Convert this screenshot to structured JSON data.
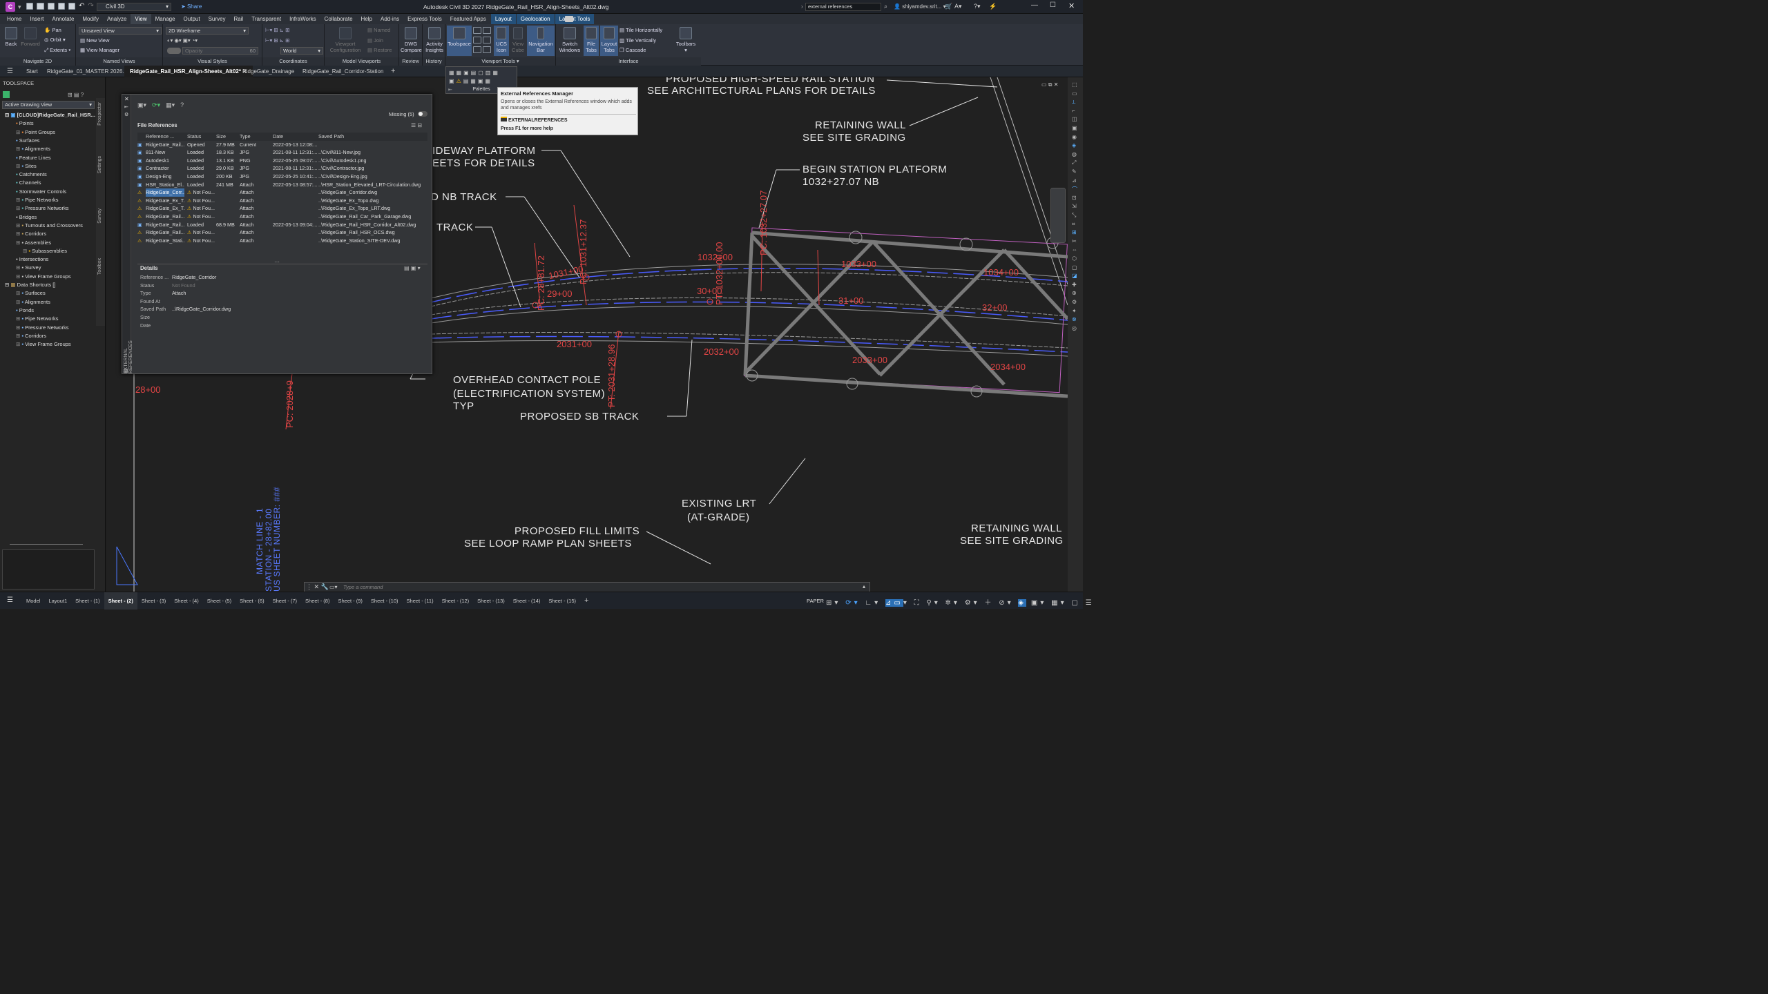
{
  "titlebar": {
    "app_badge": "C",
    "workspace": "Civil 3D",
    "share": "Share",
    "title": "Autodesk Civil 3D 2027   RidgeGate_Rail_HSR_Align-Sheets_Alt02.dwg",
    "search_value": "external references",
    "user": "shiyamdev.srit..."
  },
  "menu": {
    "items": [
      "Home",
      "Insert",
      "Annotate",
      "Modify",
      "Analyze",
      "View",
      "Manage",
      "Output",
      "Survey",
      "Rail",
      "Transparent",
      "InfraWorks",
      "Collaborate",
      "Help",
      "Add-ins",
      "Express Tools",
      "Featured Apps"
    ],
    "active": "View",
    "contextual": [
      "Layout",
      "Geolocation",
      "Layout Tools"
    ]
  },
  "ribbon": {
    "navigate": {
      "back": "Back",
      "forward": "Forward",
      "pan": "Pan",
      "orbit": "Orbit",
      "extents": "Extents",
      "label": "Navigate 2D"
    },
    "named_views": {
      "dropdown": "Unsaved View",
      "new": "New View",
      "manager": "View Manager",
      "label": "Named Views"
    },
    "visual_styles": {
      "dropdown": "2D Wireframe",
      "opacity": "Opacity",
      "opacity_value": "60",
      "label": "Visual Styles"
    },
    "coordinates": {
      "world": "World",
      "label": "Coordinates"
    },
    "model_viewports": {
      "config": "Viewport Configuration",
      "named": "Named",
      "join": "Join",
      "restore": "Restore",
      "label": "Model Viewports"
    },
    "review": {
      "dwg_compare": "DWG Compare",
      "label": "Review"
    },
    "history": {
      "activity": "Activity Insights",
      "label": "History"
    },
    "viewport_tools": {
      "toolspace": "Toolspace",
      "ucs": "UCS Icon",
      "viewcube": "View Cube",
      "navbar": "Navigation Bar",
      "label": "Viewport Tools"
    },
    "interface": {
      "switch": "Switch Windows",
      "file_tabs": "File Tabs",
      "layout_tabs": "Layout Tabs",
      "tile_h": "Tile Horizontally",
      "tile_v": "Tile Vertically",
      "cascade": "Cascade",
      "toolbars": "Toolbars",
      "label": "Interface"
    },
    "palettes_label": "Palettes"
  },
  "tabs": {
    "start": "Start",
    "items": [
      {
        "label": "RidgeGate_01_MASTER 2026.1*"
      },
      {
        "label": "RidgeGate_Rail_HSR_Align-Sheets_Alt02*"
      },
      {
        "label": "RidgeGate_Drainage"
      },
      {
        "label": "RidgeGate_Rail_Corridor-Station"
      }
    ]
  },
  "toolspace": {
    "title": "TOOLSPACE",
    "view": "Active Drawing View",
    "root": "[CLOUD]RidgeGate_Rail_HSR...",
    "items": [
      "Points",
      "Point Groups",
      "Surfaces",
      "Alignments",
      "Feature Lines",
      "Sites",
      "Catchments",
      "Channels",
      "Stormwater Controls",
      "Pipe Networks",
      "Pressure Networks",
      "Bridges",
      "Turnouts and Crossovers",
      "Corridors",
      "Assemblies",
      "Subassemblies",
      "Intersections",
      "Survey",
      "View Frame Groups"
    ],
    "shortcuts_root": "Data Shortcuts []",
    "shortcuts": [
      "Surfaces",
      "Alignments",
      "Ponds",
      "Pipe Networks",
      "Pressure Networks",
      "Corridors",
      "View Frame Groups"
    ],
    "side_tabs": [
      "Prospector",
      "Settings",
      "Survey",
      "Toolbox"
    ]
  },
  "xref": {
    "palette_title": "EXTERNAL REFERENCES",
    "missing": "Missing (5)",
    "file_refs": "File References",
    "columns": [
      "Reference ...",
      "Status",
      "Size",
      "Type",
      "Date",
      "Saved Path"
    ],
    "rows": [
      [
        "RidgeGate_Rail...",
        "Opened",
        "27.9 MB",
        "Current",
        "2022-05-13 12:08:...",
        ""
      ],
      [
        "811-New",
        "Loaded",
        "18.3 KB",
        "JPG",
        "2021-08-11 12:31:...",
        "..\\Civil\\811-New.jpg"
      ],
      [
        "Autodesk1",
        "Loaded",
        "13.1 KB",
        "PNG",
        "2022-05-25 09:07:...",
        "..\\Civil\\Autodesk1.png"
      ],
      [
        "Contractor",
        "Loaded",
        "29.0 KB",
        "JPG",
        "2021-08-11 12:31:...",
        "..\\Civil\\Contractor.jpg"
      ],
      [
        "Design-Eng",
        "Loaded",
        "200 KB",
        "JPG",
        "2022-05-25 10:41:...",
        "..\\Civil\\Design-Eng.jpg"
      ],
      [
        "HSR_Station_El...",
        "Loaded",
        "241 MB",
        "Attach",
        "2022-05-13 08:57:...",
        "..\\HSR_Station_Elevated_LRT-Circulation.dwg"
      ],
      [
        "RidgeGate_Corr...",
        "Not Fou...",
        "",
        "Attach",
        "",
        "..\\RidgeGate_Corridor.dwg"
      ],
      [
        "RidgeGate_Ex_T...",
        "Not Fou...",
        "",
        "Attach",
        "",
        "..\\RidgeGate_Ex_Topo.dwg"
      ],
      [
        "RidgeGate_Ex_T...",
        "Not Fou...",
        "",
        "Attach",
        "",
        "..\\RidgeGate_Ex_Topo_LRT.dwg"
      ],
      [
        "RidgeGate_Rail...",
        "Not Fou...",
        "",
        "Attach",
        "",
        "..\\RidgeGate_Rail_Car_Park_Garage.dwg"
      ],
      [
        "RidgeGate_Rail...",
        "Loaded",
        "68.9 MB",
        "Attach",
        "2022-05-13 09:04:...",
        "..\\RidgeGate_Rail_HSR_Corridor_Alt02.dwg"
      ],
      [
        "RidgeGate_Rail...",
        "Not Fou...",
        "",
        "Attach",
        "",
        "..\\RidgeGate_Rail_HSR_OCS.dwg"
      ],
      [
        "RidgeGate_Stati...",
        "Not Fou...",
        "",
        "Attach",
        "",
        "..\\RidgeGate_Station_SITE-DEV.dwg"
      ]
    ],
    "details_title": "Details",
    "details": [
      [
        "Reference ...",
        "RidgeGate_Corridor"
      ],
      [
        "Status",
        "Not Found"
      ],
      [
        "Type",
        "Attach"
      ],
      [
        "Found At",
        ""
      ],
      [
        "Saved Path",
        "..\\RidgeGate_Corridor.dwg"
      ],
      [
        "Size",
        ""
      ],
      [
        "Date",
        ""
      ]
    ]
  },
  "tooltip": {
    "title": "External References Manager",
    "body": "Opens or closes the External References window which adds and manages xrefs",
    "command": "EXTERNALREFERENCES",
    "help": "Press F1 for more help"
  },
  "drawing": {
    "labels": {
      "hsr1": "PROPOSED HIGH-SPEED RAIL STATION",
      "hsr2": "SEE ARCHITECTURAL PLANS FOR DETAILS",
      "rw1a": "RETAINING WALL",
      "rw1b": "SEE SITE GRADING",
      "side1": "IDEWAY PLATFORM",
      "side2": "EETS FOR DETAILS",
      "bsp1": "BEGIN STATION PLATFORM",
      "bsp2": "1032+27.07 NB",
      "nb": "D NB TRACK",
      "track": "TRACK",
      "ocp1": "OVERHEAD CONTACT POLE",
      "ocp2": "(ELECTRIFICATION SYSTEM)",
      "ocp3": "TYP",
      "sb": "PROPOSED SB TRACK",
      "lrt1": "EXISTING LRT",
      "lrt2": "(AT-GRADE)",
      "fill1": "PROPOSED FILL LIMITS",
      "fill2": "SEE LOOP RAMP PLAN SHEETS",
      "rw2a": "RETAINING WALL",
      "rw2b": "SEE SITE GRADING",
      "match1": "MATCH LINE - 1",
      "match2": "STATION - 28+82.00",
      "match3": "US SHEET NUMBER: ###"
    },
    "stations": {
      "s1031": "1031+00",
      "s1032": "1032+00",
      "s1033": "1033+00",
      "s1034": "1034+00",
      "s29": "29+00",
      "s30": "30+00",
      "s31": "31+00",
      "s32": "32+00",
      "s2031": "2031+00",
      "s2032": "2032+00",
      "s2033": "2033+00",
      "s2034": "2034+00",
      "s28": "28+00",
      "pc1": "PC: 28+81.72",
      "pc2": "PC: 1031+12.37",
      "pt1": "PT: 1032+00.00",
      "pt2": "PT: 2031+28.96",
      "pc3": "PC: 2028+9",
      "pc4": "PC: 1032+27.07"
    }
  },
  "command": {
    "placeholder": "Type a command"
  },
  "status": {
    "model": "Model",
    "sheets": [
      "Layout1",
      "Sheet - (1)",
      "Sheet - (2)",
      "Sheet - (3)",
      "Sheet - (4)",
      "Sheet - (5)",
      "Sheet - (6)",
      "Sheet - (7)",
      "Sheet - (8)",
      "Sheet - (9)",
      "Sheet - (10)",
      "Sheet - (11)",
      "Sheet - (12)",
      "Sheet - (13)",
      "Sheet - (14)",
      "Sheet - (15)"
    ],
    "active_sheet": "Sheet - (2)",
    "paper": "PAPER"
  },
  "colors": {
    "accent": "#2a6fb5",
    "red": "#e24545",
    "blue": "#4a5cff",
    "warning": "#f2b400"
  }
}
